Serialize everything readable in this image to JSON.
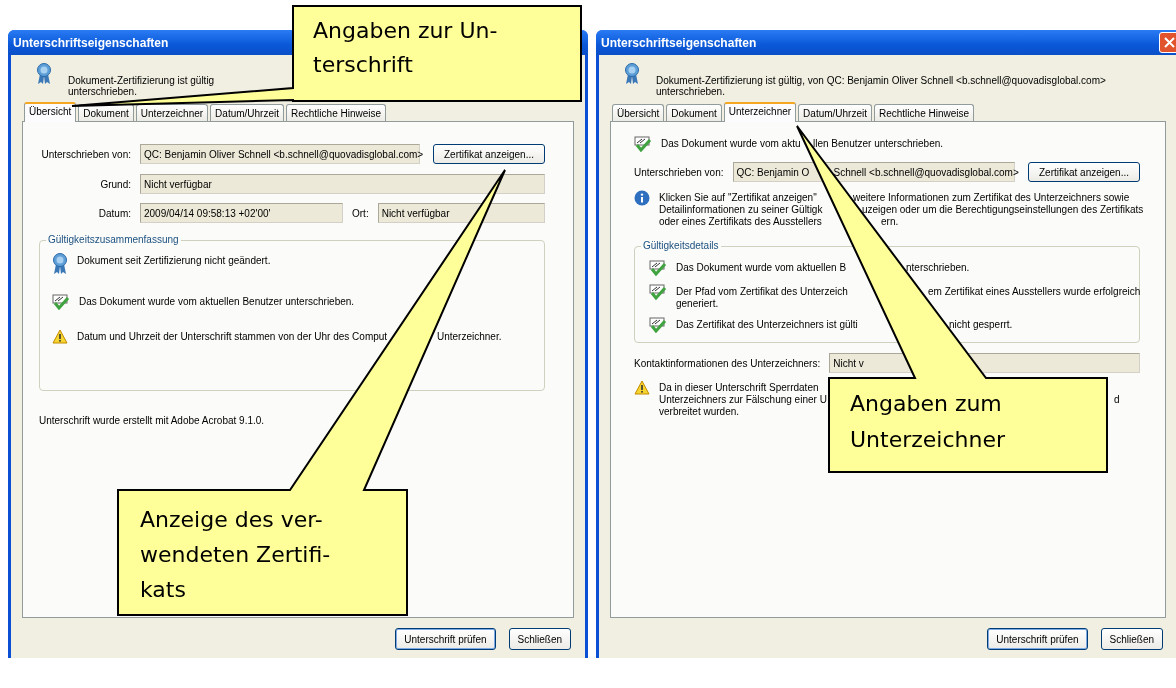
{
  "windows": [
    {
      "title": "Unterschriftseigenschaften",
      "close_button": false,
      "header": [
        "Dokument-Zertifizierung ist gültig",
        "unterschrieben."
      ],
      "tabs": [
        {
          "label": "Übersicht",
          "selected": true
        },
        {
          "label": "Dokument",
          "selected": false
        },
        {
          "label": "Unterzeichner",
          "selected": false
        },
        {
          "label": "Datum/Uhrzeit",
          "selected": false
        },
        {
          "label": "Rechtliche Hinweise",
          "selected": false
        }
      ],
      "content": [
        {
          "kind": "field_row",
          "fields": [
            {
              "label": "Unterschrieben von:",
              "value": [
                "QC: Benjamin Oliver Schnell <b.schnell@quovadisglobal.com>"
              ]
            }
          ],
          "button": "Zertifikat anzeigen..."
        },
        {
          "kind": "field_row",
          "fields": [
            {
              "label": "Grund:",
              "value": [
                "Nicht verfügbar"
              ]
            }
          ]
        },
        {
          "kind": "field_row",
          "fields": [
            {
              "label": "Datum:",
              "value": [
                "2009/04/14 09:58:13 +02'00'"
              ]
            },
            {
              "label": "Ort:",
              "value": [
                "Nicht verfügbar"
              ]
            }
          ]
        },
        {
          "kind": "group",
          "title": "Gültigkeitszusammenfassung",
          "items": [
            {
              "kind": "certified",
              "lines": [
                [
                  "Dokument seit Zertifizierung nicht geändert."
                ]
              ]
            },
            {
              "kind": "signed",
              "lines": [
                [
                  "Das Dokument wurde vom aktuellen Benutzer unterschrieben."
                ]
              ]
            },
            {
              "kind": "warning",
              "lines": [
                [
                  "Datum und Uhrzeit der Unterschrift stammen von der Uhr des Comput",
                  "Unterzeichner."
                ]
              ]
            }
          ]
        },
        {
          "kind": "note",
          "lines": [
            [
              "Unterschrift wurde erstellt mit Adobe Acrobat 9.1.0."
            ]
          ]
        }
      ],
      "buttons": [
        "Unterschrift prüfen",
        "Schließen"
      ]
    },
    {
      "title": "Unterschriftseigenschaften",
      "close_button": true,
      "header": [
        "Dokument-Zertifizierung ist gültig, von QC: Benjamin Oliver Schnell <b.schnell@quovadisglobal.com>",
        "unterschrieben."
      ],
      "tabs": [
        {
          "label": "Übersicht",
          "selected": false
        },
        {
          "label": "Dokument",
          "selected": false
        },
        {
          "label": "Unterzeichner",
          "selected": true
        },
        {
          "label": "Datum/Uhrzeit",
          "selected": false
        },
        {
          "label": "Rechtliche Hinweise",
          "selected": false
        }
      ],
      "content": [
        {
          "kind": "signed",
          "lines": [
            [
              "Das Dokument wurde vom aktu",
              "llen Benutzer unterschrieben."
            ]
          ]
        },
        {
          "kind": "field_row",
          "fields": [
            {
              "label": "Unterschrieben von:",
              "value": [
                "QC: Benjamin O",
                "Schnell <b.schnell@quovadisglobal.com>"
              ]
            }
          ],
          "button": "Zertifikat anzeigen..."
        },
        {
          "kind": "info",
          "lines": [
            [
              "Klicken Sie auf \"Zertifikat anzeigen\"",
              "weitere Informationen zum Zertifikat des Unterzeichners sowie"
            ],
            [
              "Detailinformationen zu seiner Gültigk",
              "uzeigen oder um die Berechtigungseinstellungen des Zertifikats"
            ],
            [
              "oder eines Zertifikats des Ausstellers",
              "ern."
            ]
          ]
        },
        {
          "kind": "group",
          "title": "Gültigkeitsdetails",
          "items": [
            {
              "kind": "signed",
              "lines": [
                [
                  "Das Dokument wurde vom aktuellen B",
                  "nterschrieben."
                ]
              ]
            },
            {
              "kind": "signed",
              "lines": [
                [
                  "Der Pfad vom Zertifikat des Unterzeich",
                  "em Zertifikat eines Ausstellers wurde erfolgreich"
                ],
                [
                  "generiert."
                ]
              ]
            },
            {
              "kind": "signed",
              "lines": [
                [
                  "Das Zertifikat des Unterzeichners ist gülti",
                  "nicht gesperrt."
                ]
              ]
            }
          ]
        },
        {
          "kind": "field_row",
          "fields": [
            {
              "label": "Kontaktinformationen des Unterzeichners:",
              "value": [
                "Nicht v"
              ]
            }
          ]
        },
        {
          "kind": "warning",
          "lines": [
            [
              "Da in dieser Unterschrift Sperrdaten"
            ],
            [
              "Unterzeichners zur Fälschung einer U",
              "d"
            ],
            [
              "verbreitet wurden."
            ]
          ]
        }
      ],
      "buttons": [
        "Unterschrift prüfen",
        "Schließen"
      ]
    }
  ],
  "callouts": [
    {
      "lines": [
        "Angaben zur Un-",
        "terschrift"
      ]
    },
    {
      "lines": [
        "Anzeige des ver-",
        "wendeten Zertifi-",
        "kats"
      ]
    },
    {
      "lines": [
        "Angaben zum",
        "Unterzeichner"
      ]
    }
  ]
}
